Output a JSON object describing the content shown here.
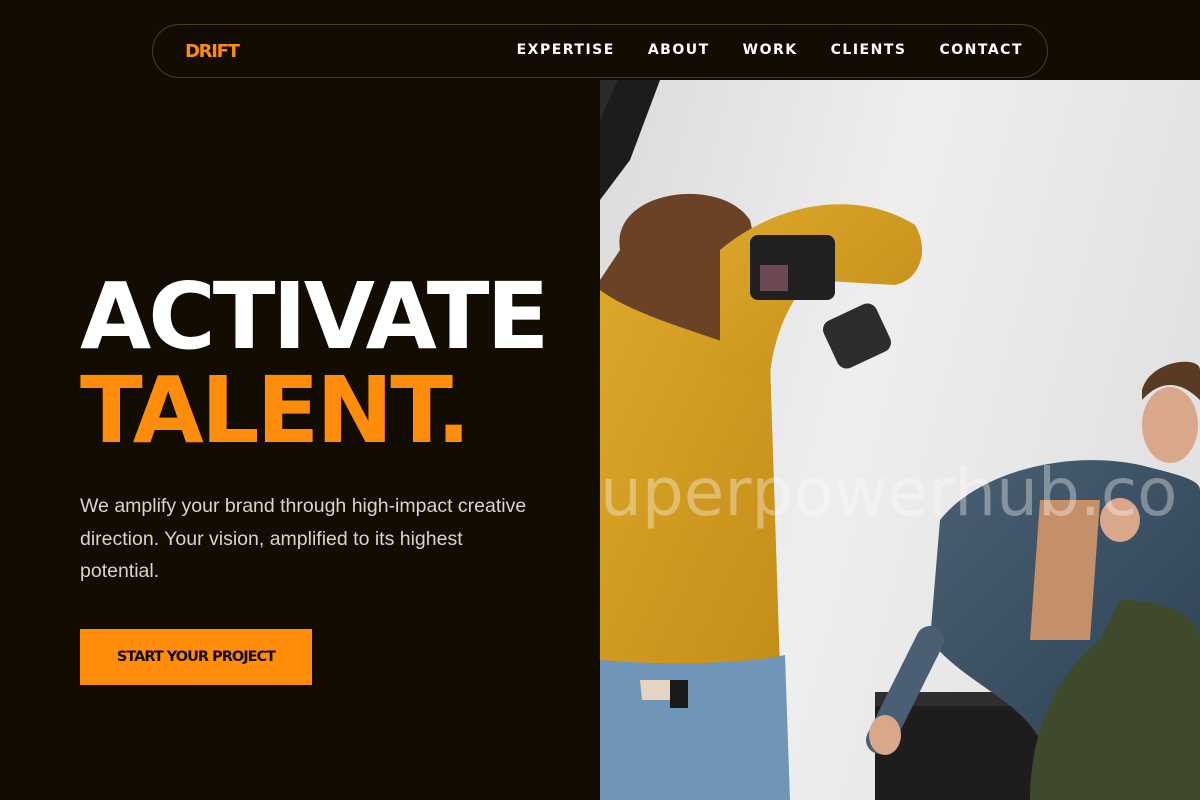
{
  "brand": {
    "logo": "DRIFT",
    "accent": "#ff8c0a",
    "background": "#120c02"
  },
  "nav": {
    "items": [
      {
        "label": "EXPERTISE"
      },
      {
        "label": "ABOUT"
      },
      {
        "label": "WORK"
      },
      {
        "label": "CLIENTS"
      },
      {
        "label": "CONTACT"
      }
    ]
  },
  "hero": {
    "title_line1": "ACTIVATE",
    "title_line2": "TALENT.",
    "subtitle": "We amplify your brand through high-impact creative direction. Your vision, amplified to its highest potential.",
    "cta_label": "START YOUR PROJECT"
  },
  "image": {
    "watermark": "uperpowerhub.co"
  }
}
